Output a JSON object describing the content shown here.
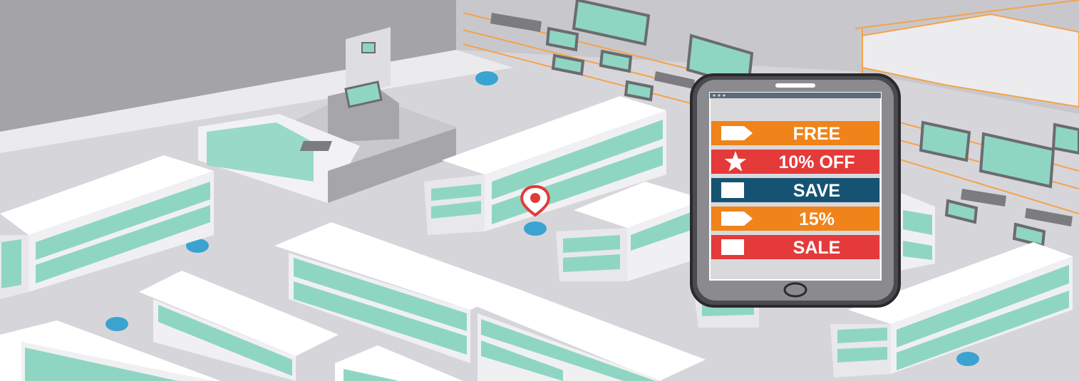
{
  "illustration": {
    "subject": "store-floor-with-beacons-and-phone-offers",
    "colors": {
      "floor": "#d4d4d8",
      "wall": "#9b9ba0",
      "shelf_top": "#ffffff",
      "shelf_glass": "#8fd6c2",
      "beacon": "#3aa3cf",
      "pin": "#e23a3a",
      "accent_outline": "#f5a24b"
    }
  },
  "phone": {
    "icon": "smartphone-icon",
    "offers": [
      {
        "label": "FREE",
        "icon": "tag-icon",
        "color": "#f08319"
      },
      {
        "label": "10% OFF",
        "icon": "star-icon",
        "color": "#e43a3a"
      },
      {
        "label": "SAVE",
        "icon": "square-icon",
        "color": "#165373"
      },
      {
        "label": "15%",
        "icon": "tag-icon",
        "color": "#f08319"
      },
      {
        "label": "SALE",
        "icon": "square-icon",
        "color": "#e43a3a"
      }
    ]
  }
}
